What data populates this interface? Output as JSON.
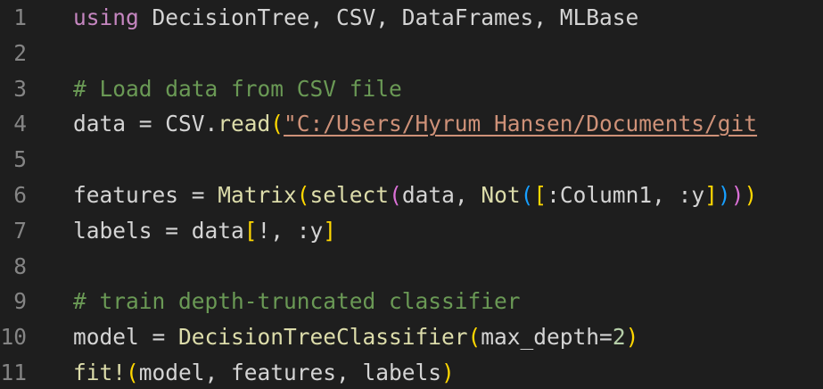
{
  "colors": {
    "background": "#1e1e1e",
    "line_number": "#858585",
    "plain": "#d4d4d4",
    "keyword": "#c586c0",
    "function": "#dcdcaa",
    "string": "#ce9178",
    "comment": "#6a9955",
    "number": "#b5cea8",
    "bracket_level_1": "#ffd700",
    "bracket_level_2": "#da70d6",
    "bracket_level_3": "#179fff"
  },
  "lines": [
    {
      "number": "1",
      "tokens": [
        {
          "text": "using",
          "type": "kw"
        },
        {
          "text": " DecisionTree, CSV, DataFrames, MLBase",
          "type": "plain"
        }
      ]
    },
    {
      "number": "2",
      "tokens": []
    },
    {
      "number": "3",
      "tokens": [
        {
          "text": "# Load data from CSV file",
          "type": "cmt"
        }
      ]
    },
    {
      "number": "4",
      "tokens": [
        {
          "text": "data = CSV.",
          "type": "plain"
        },
        {
          "text": "read",
          "type": "fn"
        },
        {
          "text": "(",
          "type": "b1"
        },
        {
          "text": "\"C:/Users/Hyrum Hansen/Documents/git",
          "type": "str"
        }
      ]
    },
    {
      "number": "5",
      "tokens": []
    },
    {
      "number": "6",
      "tokens": [
        {
          "text": "features = ",
          "type": "plain"
        },
        {
          "text": "Matrix",
          "type": "fn"
        },
        {
          "text": "(",
          "type": "b1"
        },
        {
          "text": "select",
          "type": "fn"
        },
        {
          "text": "(",
          "type": "b2"
        },
        {
          "text": "data, ",
          "type": "plain"
        },
        {
          "text": "Not",
          "type": "fn"
        },
        {
          "text": "(",
          "type": "b3"
        },
        {
          "text": "[",
          "type": "b1"
        },
        {
          "text": ":Column1, :y",
          "type": "plain"
        },
        {
          "text": "]",
          "type": "b1"
        },
        {
          "text": ")",
          "type": "b3"
        },
        {
          "text": ")",
          "type": "b2"
        },
        {
          "text": ")",
          "type": "b1"
        }
      ]
    },
    {
      "number": "7",
      "tokens": [
        {
          "text": "labels = data",
          "type": "plain"
        },
        {
          "text": "[",
          "type": "b1"
        },
        {
          "text": "!, :y",
          "type": "plain"
        },
        {
          "text": "]",
          "type": "b1"
        }
      ]
    },
    {
      "number": "8",
      "tokens": []
    },
    {
      "number": "9",
      "tokens": [
        {
          "text": "# train depth-truncated classifier",
          "type": "cmt"
        }
      ]
    },
    {
      "number": "10",
      "tokens": [
        {
          "text": "model = ",
          "type": "plain"
        },
        {
          "text": "DecisionTreeClassifier",
          "type": "fn"
        },
        {
          "text": "(",
          "type": "b1"
        },
        {
          "text": "max_depth=",
          "type": "plain"
        },
        {
          "text": "2",
          "type": "num"
        },
        {
          "text": ")",
          "type": "b1"
        }
      ]
    },
    {
      "number": "11",
      "tokens": [
        {
          "text": "fit!",
          "type": "fn"
        },
        {
          "text": "(",
          "type": "b1"
        },
        {
          "text": "model, features, labels",
          "type": "plain"
        },
        {
          "text": ")",
          "type": "b1"
        }
      ]
    }
  ]
}
